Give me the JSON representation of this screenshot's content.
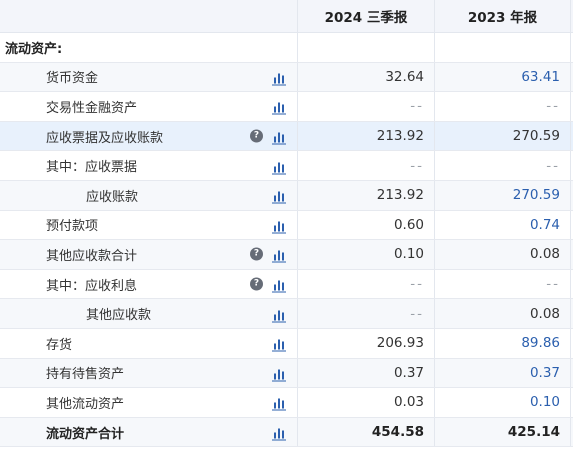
{
  "header": {
    "col1": "2024 三季报",
    "col2": "2023 年报"
  },
  "section": {
    "title": "流动资产:"
  },
  "icons": {
    "chart": "bar-chart-icon",
    "help": "question-icon",
    "help_glyph": "?"
  },
  "colors": {
    "blue_value": "#2b5fae",
    "highlight_row": "#e8f1fc",
    "header_bg": "#f3f5fa"
  },
  "rows": [
    {
      "label": "货币资金",
      "v1": "32.64",
      "v2": "63.41"
    },
    {
      "label": "交易性金融资产",
      "v1": "--",
      "v2": "--"
    },
    {
      "label": "应收票据及应收账款",
      "v1": "213.92",
      "v2": "270.59"
    },
    {
      "label": "其中：应收票据",
      "v1": "--",
      "v2": "--"
    },
    {
      "label": "应收账款",
      "v1": "213.92",
      "v2": "270.59"
    },
    {
      "label": "预付款项",
      "v1": "0.60",
      "v2": "0.74"
    },
    {
      "label": "其他应收款合计",
      "v1": "0.10",
      "v2": "0.08"
    },
    {
      "label": "其中：应收利息",
      "v1": "--",
      "v2": "--"
    },
    {
      "label": "其他应收款",
      "v1": "--",
      "v2": "0.08"
    },
    {
      "label": "存货",
      "v1": "206.93",
      "v2": "89.86"
    },
    {
      "label": "持有待售资产",
      "v1": "0.37",
      "v2": "0.37"
    },
    {
      "label": "其他流动资产",
      "v1": "0.03",
      "v2": "0.10"
    },
    {
      "label": "流动资产合计",
      "v1": "454.58",
      "v2": "425.14"
    }
  ]
}
